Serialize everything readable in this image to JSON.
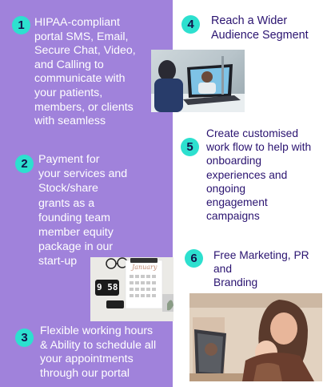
{
  "items": [
    {
      "number": "1",
      "text": "HIPAA-compliant\nportal  SMS, Email,\nSecure Chat, Video,\nand Calling to\ncommunicate with\n your patients,\nmembers, or clients\nwith seamless"
    },
    {
      "number": "2",
      "text": "Payment for\nyour services and\nStock/share\ngrants as a\nfounding team\nmember equity\npackage in our\nstart-up"
    },
    {
      "number": "3",
      "text": "Flexible working hours\n& Ability to schedule all\nyour appointments\nthrough our portal"
    },
    {
      "number": "4",
      "text": "Reach a Wider\nAudience Segment"
    },
    {
      "number": "5",
      "text": "Create customised\nwork flow to help with\nonboarding\nexperiences and\nongoing\nengagement\ncampaigns"
    },
    {
      "number": "6",
      "text": "Free Marketing, PR and\nBranding"
    }
  ],
  "clock_time": "9 58",
  "calendar_title": "January"
}
